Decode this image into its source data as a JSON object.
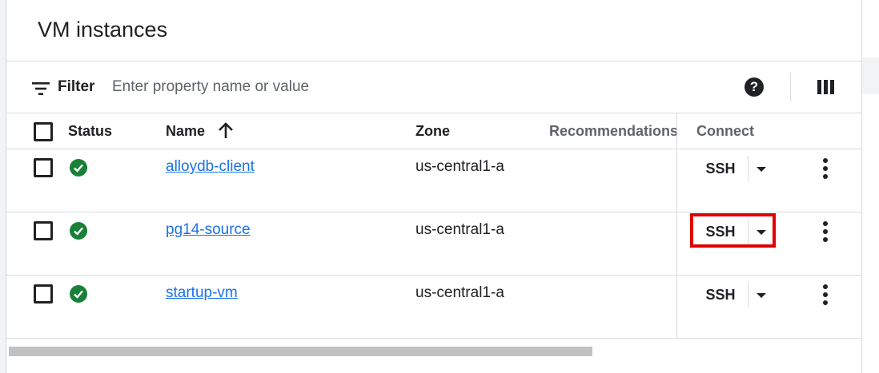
{
  "page": {
    "title": "VM instances"
  },
  "filter": {
    "label": "Filter",
    "placeholder": "Enter property name or value"
  },
  "toolbar": {
    "help_icon": "help-icon",
    "columns_icon": "column-display-icon",
    "help_glyph": "?"
  },
  "table": {
    "headers": {
      "status": "Status",
      "name": "Name",
      "zone": "Zone",
      "recommendations": "Recommendations",
      "connect": "Connect"
    },
    "sort": {
      "column": "name",
      "direction": "ascending",
      "icon": "arrow-up-icon"
    },
    "rows": [
      {
        "name": "alloydb-client",
        "zone": "us-central1-a",
        "status": "running",
        "connect": "SSH"
      },
      {
        "name": "pg14-source",
        "zone": "us-central1-a",
        "status": "running",
        "connect": "SSH",
        "highlighted": true
      },
      {
        "name": "startup-vm",
        "zone": "us-central1-a",
        "status": "running",
        "connect": "SSH"
      }
    ]
  },
  "colors": {
    "status_running": "#188038",
    "link": "#1a73e8",
    "highlight": "#e00000",
    "text": "#202124",
    "muted": "#5f6368",
    "border": "#dadce0"
  }
}
